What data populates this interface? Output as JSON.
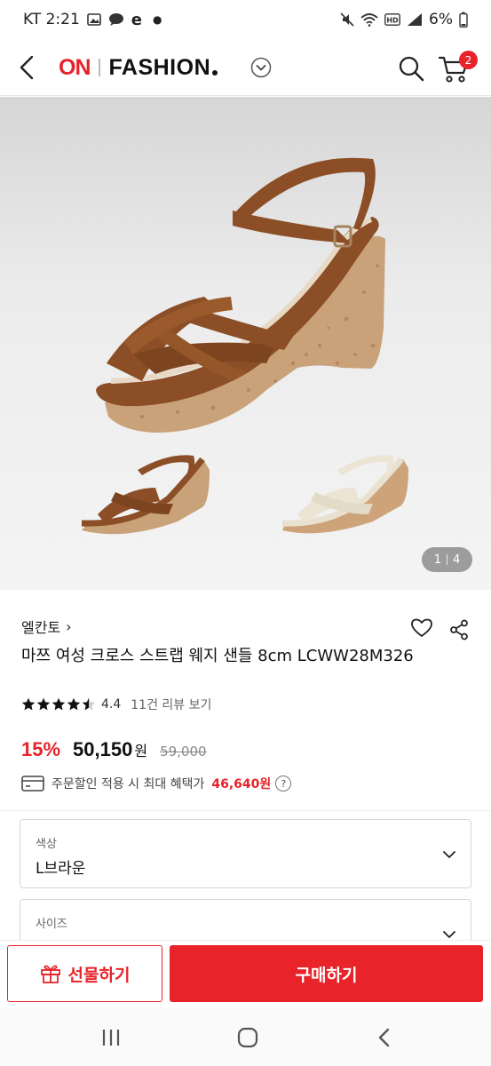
{
  "status_bar": {
    "carrier_time": "KT 2:21",
    "battery": "6%",
    "icons": [
      "image-icon",
      "chat-icon",
      "e-icon",
      "dot-icon",
      "mute-icon",
      "wifi-icon",
      "hd-icon",
      "signal-icon",
      "battery-icon"
    ]
  },
  "header": {
    "logo_on": "ON",
    "logo_fashion": "FASHION",
    "cart_count": "2"
  },
  "gallery": {
    "current": "1",
    "total": "4"
  },
  "product": {
    "brand": "엘칸토",
    "brand_arrow": "›",
    "title": "마쯔 여성 크로스 스트랩 웨지 샌들 8cm LCWW28M326",
    "rating": "4.4",
    "rating_value": 4.4,
    "review_link": "11건 리뷰 보기",
    "discount": "15%",
    "price": "50,150",
    "price_unit": "원",
    "original_price": "59,000",
    "benefit_text": "주문할인 적용 시 최대 혜택가",
    "benefit_amount": "46,640원",
    "help_mark": "?"
  },
  "options": {
    "color_label": "색상",
    "color_value": "L브라운",
    "size_label": "사이즈"
  },
  "actions": {
    "gift_label": "선물하기",
    "buy_label": "구매하기"
  },
  "colors": {
    "accent": "#e8232a",
    "leather": "#8b4e26",
    "cork": "#c9a27a"
  }
}
